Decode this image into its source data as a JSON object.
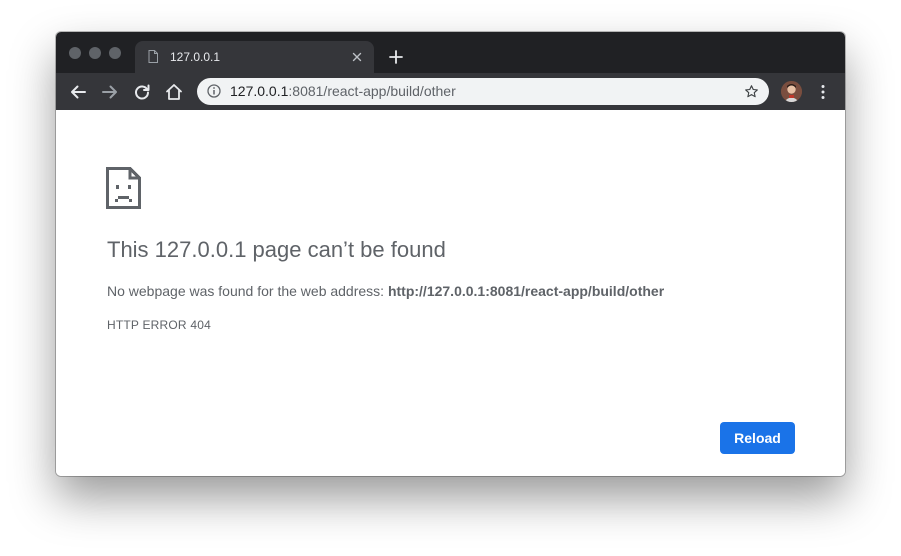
{
  "colors": {
    "tabstrip_bg": "#202124",
    "toolbar_bg": "#35363a",
    "omnibox_bg": "#f1f3f4",
    "accent": "#1a73e8",
    "text_secondary": "#5f6368"
  },
  "tab": {
    "title": "127.0.0.1",
    "favicon": "page-icon"
  },
  "toolbar": {
    "back_icon": "back-arrow-icon",
    "forward_icon": "forward-arrow-icon",
    "reload_icon": "reload-icon",
    "home_icon": "home-icon",
    "menu_icon": "more-vert-icon"
  },
  "omnibox": {
    "url_host": "127.0.0.1",
    "url_rest": ":8081/react-app/build/other",
    "info_icon": "info-icon",
    "bookmark_icon": "star-icon"
  },
  "error": {
    "icon": "sad-page-icon",
    "title": "This 127.0.0.1 page can’t be found",
    "description_prefix": "No webpage was found for the web address: ",
    "description_url": "http://127.0.0.1:8081/react-app/build/other",
    "code": "HTTP ERROR 404",
    "reload_label": "Reload"
  }
}
